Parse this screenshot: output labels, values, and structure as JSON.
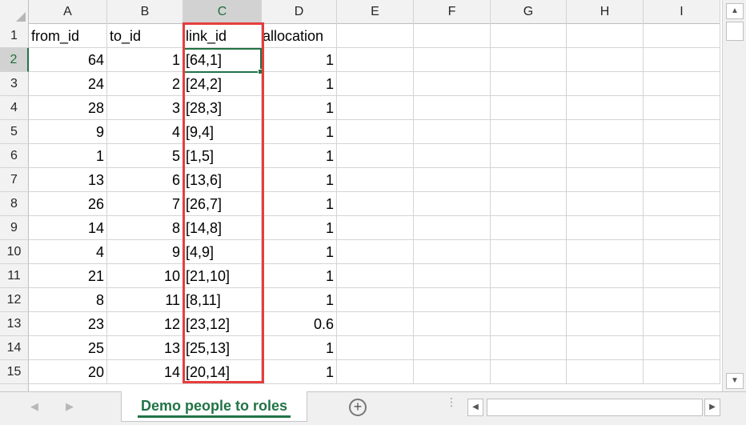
{
  "columns": [
    "A",
    "B",
    "C",
    "D",
    "E",
    "F",
    "G",
    "H",
    "I"
  ],
  "rows": [
    {
      "n": "1",
      "a": "from_id",
      "b": "to_id",
      "c": "link_id",
      "d": "allocation"
    },
    {
      "n": "2",
      "a": "64",
      "b": "1",
      "c": "[64,1]",
      "d": "1"
    },
    {
      "n": "3",
      "a": "24",
      "b": "2",
      "c": "[24,2]",
      "d": "1"
    },
    {
      "n": "4",
      "a": "28",
      "b": "3",
      "c": "[28,3]",
      "d": "1"
    },
    {
      "n": "5",
      "a": "9",
      "b": "4",
      "c": "[9,4]",
      "d": "1"
    },
    {
      "n": "6",
      "a": "1",
      "b": "5",
      "c": "[1,5]",
      "d": "1"
    },
    {
      "n": "7",
      "a": "13",
      "b": "6",
      "c": "[13,6]",
      "d": "1"
    },
    {
      "n": "8",
      "a": "26",
      "b": "7",
      "c": "[26,7]",
      "d": "1"
    },
    {
      "n": "9",
      "a": "14",
      "b": "8",
      "c": "[14,8]",
      "d": "1"
    },
    {
      "n": "10",
      "a": "4",
      "b": "9",
      "c": "[4,9]",
      "d": "1"
    },
    {
      "n": "11",
      "a": "21",
      "b": "10",
      "c": "[21,10]",
      "d": "1"
    },
    {
      "n": "12",
      "a": "8",
      "b": "11",
      "c": "[8,11]",
      "d": "1"
    },
    {
      "n": "13",
      "a": "23",
      "b": "12",
      "c": "[23,12]",
      "d": "0.6"
    },
    {
      "n": "14",
      "a": "25",
      "b": "13",
      "c": "[25,13]",
      "d": "1"
    },
    {
      "n": "15",
      "a": "20",
      "b": "14",
      "c": "[20,14]",
      "d": "1"
    }
  ],
  "active_cell": "C2",
  "sheet_tab": {
    "label": "Demo people to roles"
  },
  "add_sheet": {
    "label": "+"
  },
  "scroll": {
    "up": "▲",
    "down": "▼",
    "left": "◀",
    "right": "▶"
  },
  "sheet_nav": {
    "prev": "◀",
    "next": "▶"
  },
  "split_handle": "⋮",
  "colors": {
    "accent_green": "#217346",
    "highlight_red": "#e53e3e",
    "header_bg": "#f2f2f2"
  }
}
